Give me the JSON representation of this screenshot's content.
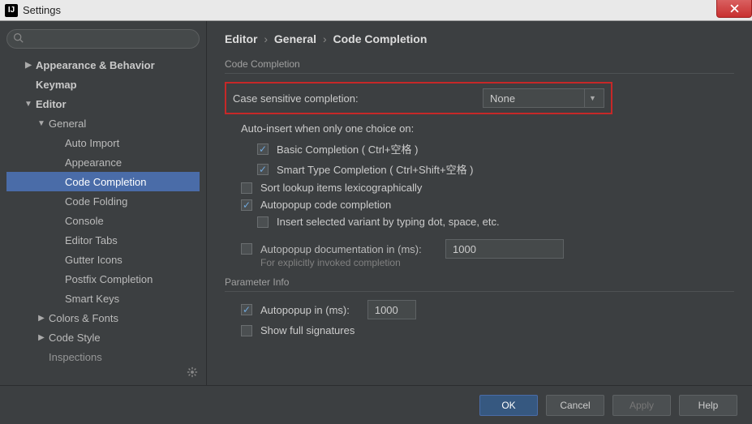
{
  "window": {
    "title": "Settings",
    "app_icon_text": "IJ"
  },
  "sidebar": {
    "search_placeholder": "",
    "items": [
      {
        "label": "Appearance & Behavior",
        "bold": true,
        "arrow": "right",
        "indent": 0
      },
      {
        "label": "Keymap",
        "bold": true,
        "arrow": "",
        "indent": 0
      },
      {
        "label": "Editor",
        "bold": true,
        "arrow": "down",
        "indent": 0
      },
      {
        "label": "General",
        "bold": false,
        "arrow": "down",
        "indent": 1
      },
      {
        "label": "Auto Import",
        "bold": false,
        "arrow": "",
        "indent": 2
      },
      {
        "label": "Appearance",
        "bold": false,
        "arrow": "",
        "indent": 2
      },
      {
        "label": "Code Completion",
        "bold": false,
        "arrow": "",
        "indent": 2,
        "selected": true
      },
      {
        "label": "Code Folding",
        "bold": false,
        "arrow": "",
        "indent": 2
      },
      {
        "label": "Console",
        "bold": false,
        "arrow": "",
        "indent": 2
      },
      {
        "label": "Editor Tabs",
        "bold": false,
        "arrow": "",
        "indent": 2
      },
      {
        "label": "Gutter Icons",
        "bold": false,
        "arrow": "",
        "indent": 2
      },
      {
        "label": "Postfix Completion",
        "bold": false,
        "arrow": "",
        "indent": 2
      },
      {
        "label": "Smart Keys",
        "bold": false,
        "arrow": "",
        "indent": 2
      },
      {
        "label": "Colors & Fonts",
        "bold": false,
        "arrow": "right",
        "indent": 1
      },
      {
        "label": "Code Style",
        "bold": false,
        "arrow": "right",
        "indent": 1
      },
      {
        "label": "Inspections",
        "bold": false,
        "arrow": "",
        "indent": 1,
        "cut": true
      }
    ]
  },
  "breadcrumb": {
    "a": "Editor",
    "b": "General",
    "c": "Code Completion",
    "sep": "›"
  },
  "section1": {
    "title": "Code Completion",
    "case_label": "Case sensitive completion:",
    "case_value": "None",
    "subheader": "Auto-insert when only one choice on:",
    "basic": "Basic Completion ( Ctrl+空格 )",
    "smart": "Smart Type Completion ( Ctrl+Shift+空格 )",
    "sort": "Sort lookup items lexicographically",
    "autopopup": "Autopopup code completion",
    "insert_variant": "Insert selected variant by typing dot, space, etc.",
    "doc_label": "Autopopup documentation in (ms):",
    "doc_value": "1000",
    "doc_hint": "For explicitly invoked completion"
  },
  "section2": {
    "title": "Parameter Info",
    "autopopup_label": "Autopopup in (ms):",
    "autopopup_value": "1000",
    "show_full": "Show full signatures"
  },
  "footer": {
    "ok": "OK",
    "cancel": "Cancel",
    "apply": "Apply",
    "help": "Help"
  }
}
